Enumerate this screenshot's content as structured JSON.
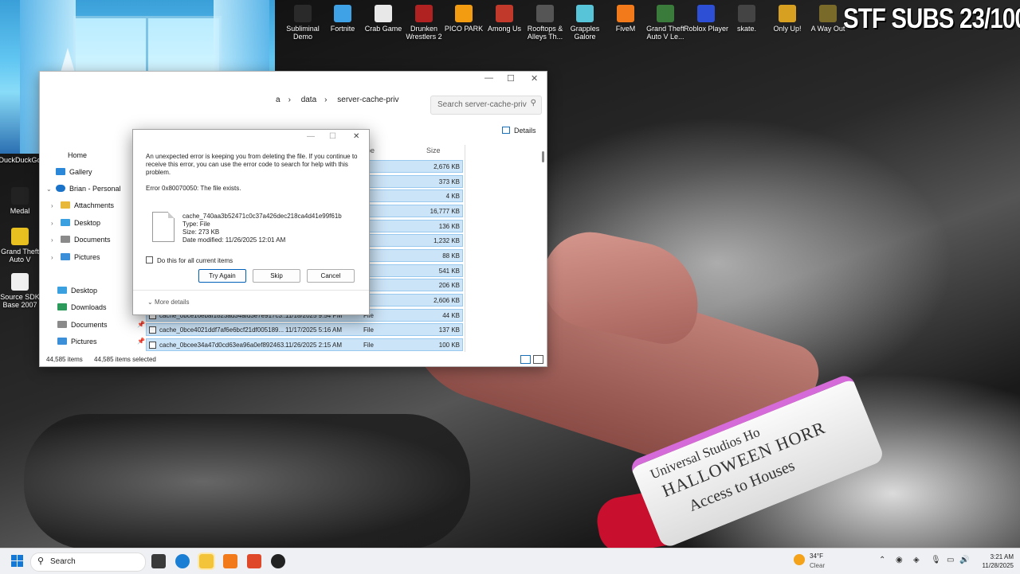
{
  "overlay": {
    "subs_text": "STF SUBS 23/100"
  },
  "desktop_icons_top": [
    {
      "label": "Subliminal Demo",
      "color": "#2a2a2a"
    },
    {
      "label": "Fortnite",
      "color": "#3fa2e6"
    },
    {
      "label": "Crab Game",
      "color": "#e8e8e8"
    },
    {
      "label": "Drunken Wrestlers 2",
      "color": "#b02222"
    },
    {
      "label": "PICO PARK",
      "color": "#f39c12"
    },
    {
      "label": "Among Us",
      "color": "#c0392b"
    },
    {
      "label": "Rooftops & Alleys Th...",
      "color": "#555555"
    },
    {
      "label": "Grapples Galore",
      "color": "#58c4d8"
    },
    {
      "label": "FiveM",
      "color": "#f27a1a"
    },
    {
      "label": "Grand Theft Auto V Le...",
      "color": "#3a7a3a"
    },
    {
      "label": "Roblox Player",
      "color": "#2c4fd6"
    },
    {
      "label": "skate.",
      "color": "#444444"
    },
    {
      "label": "Only Up!",
      "color": "#d8a020"
    },
    {
      "label": "A Way Out",
      "color": "#7a6a2a"
    }
  ],
  "desktop_icons_left": [
    {
      "label": "DuckDuckGo",
      "color": "#de5833"
    },
    {
      "label": "Medal",
      "color": "#222222"
    },
    {
      "label": "Grand Theft Auto V",
      "color": "#e8c020"
    },
    {
      "label": "Source SDK Base 2007",
      "color": "#f0f0f0"
    }
  ],
  "wristband": {
    "line1": "Universal Studios Ho",
    "line2": "HALLOWEEN HORR",
    "line3": "Access to Houses"
  },
  "explorer": {
    "breadcrumb": [
      "a",
      "data",
      "server-cache-priv"
    ],
    "search_placeholder": "Search server-cache-priv",
    "details_label": "Details",
    "col_type": "pe",
    "col_size": "Size",
    "nav": {
      "home": "Home",
      "gallery": "Gallery",
      "brian": "Brian - Personal",
      "attachments": "Attachments",
      "desktop1": "Desktop",
      "documents1": "Documents",
      "pictures1": "Pictures",
      "desktop2": "Desktop",
      "downloads": "Downloads",
      "documents2": "Documents",
      "pictures2": "Pictures"
    },
    "rows": [
      {
        "name": "",
        "date": "",
        "type": "e",
        "size": "2,676 KB"
      },
      {
        "name": "",
        "date": "",
        "type": "e",
        "size": "373 KB"
      },
      {
        "name": "",
        "date": "",
        "type": "e",
        "size": "4 KB"
      },
      {
        "name": "",
        "date": "",
        "type": "e",
        "size": "16,777 KB"
      },
      {
        "name": "",
        "date": "",
        "type": "e",
        "size": "136 KB"
      },
      {
        "name": "",
        "date": "",
        "type": "e",
        "size": "1,232 KB"
      },
      {
        "name": "",
        "date": "",
        "type": "e",
        "size": "88 KB"
      },
      {
        "name": "",
        "date": "",
        "type": "e",
        "size": "541 KB"
      },
      {
        "name": "",
        "date": "",
        "type": "e",
        "size": "206 KB"
      },
      {
        "name": "",
        "date": "",
        "type": "e",
        "size": "2,606 KB"
      },
      {
        "name": "cache_0bce16ebaf1823ad34afd3e7e917c3...",
        "date": "11/18/2025 9:54 PM",
        "type": "File",
        "size": "44 KB"
      },
      {
        "name": "cache_0bce4021ddf7af6e6bcf21df005189...",
        "date": "11/17/2025 5:16 AM",
        "type": "File",
        "size": "137 KB"
      },
      {
        "name": "cache_0bcee34a47d0cd63ea96a0ef892463...",
        "date": "11/26/2025 2:15 AM",
        "type": "File",
        "size": "100 KB"
      }
    ],
    "status_items": "44,585 items",
    "status_selected": "44,585 items selected"
  },
  "dialog": {
    "message": "An unexpected error is keeping you from deleting the file. If you continue to receive this error, you can use the error code to search for help with this problem.",
    "error": "Error 0x80070050: The file exists.",
    "file_name": "cache_740aa3b52471c0c37a426dec218ca4d41e99f61b",
    "file_type": "Type: File",
    "file_size": "Size: 273 KB",
    "file_date": "Date modified: 11/26/2025 12:01 AM",
    "checkbox_label": "Do this for all current items",
    "try_again": "Try Again",
    "skip": "Skip",
    "cancel": "Cancel",
    "more_details": "More details"
  },
  "taskbar": {
    "search_label": "Search",
    "weather_temp": "34°F",
    "weather_cond": "Clear",
    "time": "3:21 AM",
    "date": "11/28/2025"
  }
}
